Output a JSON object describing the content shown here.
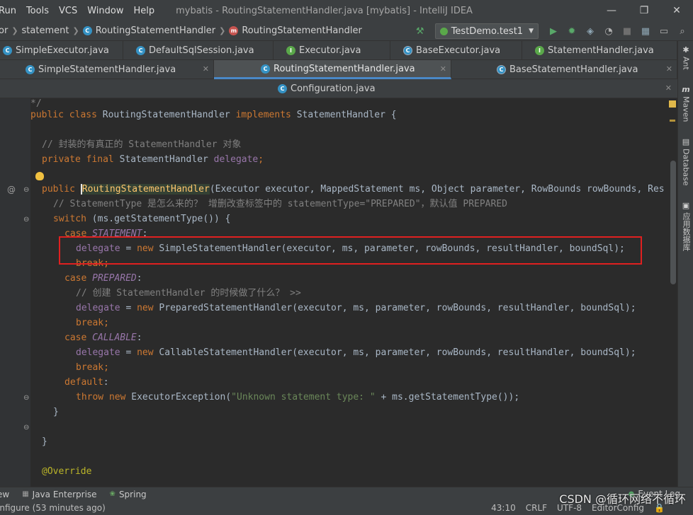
{
  "menubar": {
    "items": [
      "Run",
      "Tools",
      "VCS",
      "Window",
      "Help"
    ],
    "title": "mybatis - RoutingStatementHandler.java [mybatis] - IntelliJ IDEA",
    "controls": [
      "—",
      "❐",
      "✕"
    ]
  },
  "navbar": {
    "crumbs": [
      {
        "label": "or"
      },
      {
        "label": "statement"
      },
      {
        "label": "RoutingStatementHandler",
        "icon": "c"
      },
      {
        "label": "RoutingStatementHandler",
        "icon": "m"
      }
    ],
    "run_config": "TestDemo.test1"
  },
  "tabs_row1": [
    {
      "label": "SimpleExecutor.java",
      "icon": "c"
    },
    {
      "label": "DefaultSqlSession.java",
      "icon": "c"
    },
    {
      "label": "Executor.java",
      "icon": "i"
    },
    {
      "label": "BaseExecutor.java",
      "icon": "a"
    },
    {
      "label": "StatementHandler.java",
      "icon": "i"
    }
  ],
  "tabs_row2": [
    {
      "label": "SimpleStatementHandler.java",
      "icon": "c"
    },
    {
      "label": "RoutingStatementHandler.java",
      "icon": "c",
      "active": true
    },
    {
      "label": "BaseStatementHandler.java",
      "icon": "a"
    }
  ],
  "tabs_row3": [
    {
      "label": "Configuration.java",
      "icon": "c"
    }
  ],
  "right_tools": [
    {
      "label": "Ant",
      "glyph": "🐜"
    },
    {
      "label": "Maven",
      "glyph": "m"
    },
    {
      "label": "Database",
      "glyph": "▤"
    },
    {
      "label": "应用数据库",
      "glyph": "▣"
    }
  ],
  "code": {
    "l01": "*/",
    "l02a": "public class ",
    "l02b": "RoutingStatementHandler ",
    "l02c": "implements ",
    "l02d": "StatementHandler {",
    "l04": "// 封装的有真正的 StatementHandler 对象",
    "l05a": "private final ",
    "l05b": "StatementHandler ",
    "l05c": "delegate",
    "l05d": ";",
    "l07a": "public ",
    "l07b": "RoutingStatementHandler",
    "l07c": "(Executor executor, MappedStatement ms, Object parameter, RowBounds rowBounds, Res",
    "l08": "// StatementType 是怎么来的？ 增删改查标签中的 statementType=\"PREPARED\"，默认值 PREPARED",
    "l09a": "switch ",
    "l09b": "(ms.getStatementType()) {",
    "l10a": "case ",
    "l10b": "STATEMENT",
    "l10c": ":",
    "l11a": "delegate",
    "l11b": " = ",
    "l11c": "new ",
    "l11d": "SimpleStatementHandler(executor, ms, parameter, rowBounds, resultHandler, boundSql);",
    "l12": "break;",
    "l13a": "case ",
    "l13b": "PREPARED",
    "l13c": ":",
    "l14": "// 创建 StatementHandler 的时候做了什么？ >>",
    "l15a": "delegate",
    "l15b": " = ",
    "l15c": "new ",
    "l15d": "PreparedStatementHandler(executor, ms, parameter, rowBounds, resultHandler, boundSql);",
    "l16": "break;",
    "l17a": "case ",
    "l17b": "CALLABLE",
    "l17c": ":",
    "l18a": "delegate",
    "l18b": " = ",
    "l18c": "new ",
    "l18d": "CallableStatementHandler(executor, ms, parameter, rowBounds, resultHandler, boundSql);",
    "l19": "break;",
    "l20a": "default",
    "l20b": ":",
    "l21a": "throw new ",
    "l21b": "ExecutorException(",
    "l21c": "\"Unknown statement type: \"",
    "l21d": " + ms.getStatementType());",
    "l22": "}",
    "l24": "}",
    "l26": "@Override",
    "gutter_at": "@"
  },
  "bottom_tools": [
    {
      "label": "ew",
      "icon": ""
    },
    {
      "label": "Java Enterprise",
      "icon": "▦"
    },
    {
      "label": "Spring",
      "icon": "❀"
    }
  ],
  "event_log": "Event Log",
  "status": {
    "message": "onfigure (53 minutes ago)",
    "position": "43:10",
    "line_sep": "CRLF",
    "encoding": "UTF-8",
    "editor_config": "EditorConfig"
  },
  "watermark": "CSDN @循环网络不循环",
  "colors": {
    "keyword": "#cc7832",
    "comment": "#808080",
    "field": "#9876aa",
    "string": "#6a8759",
    "annotation": "#bbb529",
    "highlight_box": "#e02020",
    "tab_underline": "#4a88c7"
  }
}
